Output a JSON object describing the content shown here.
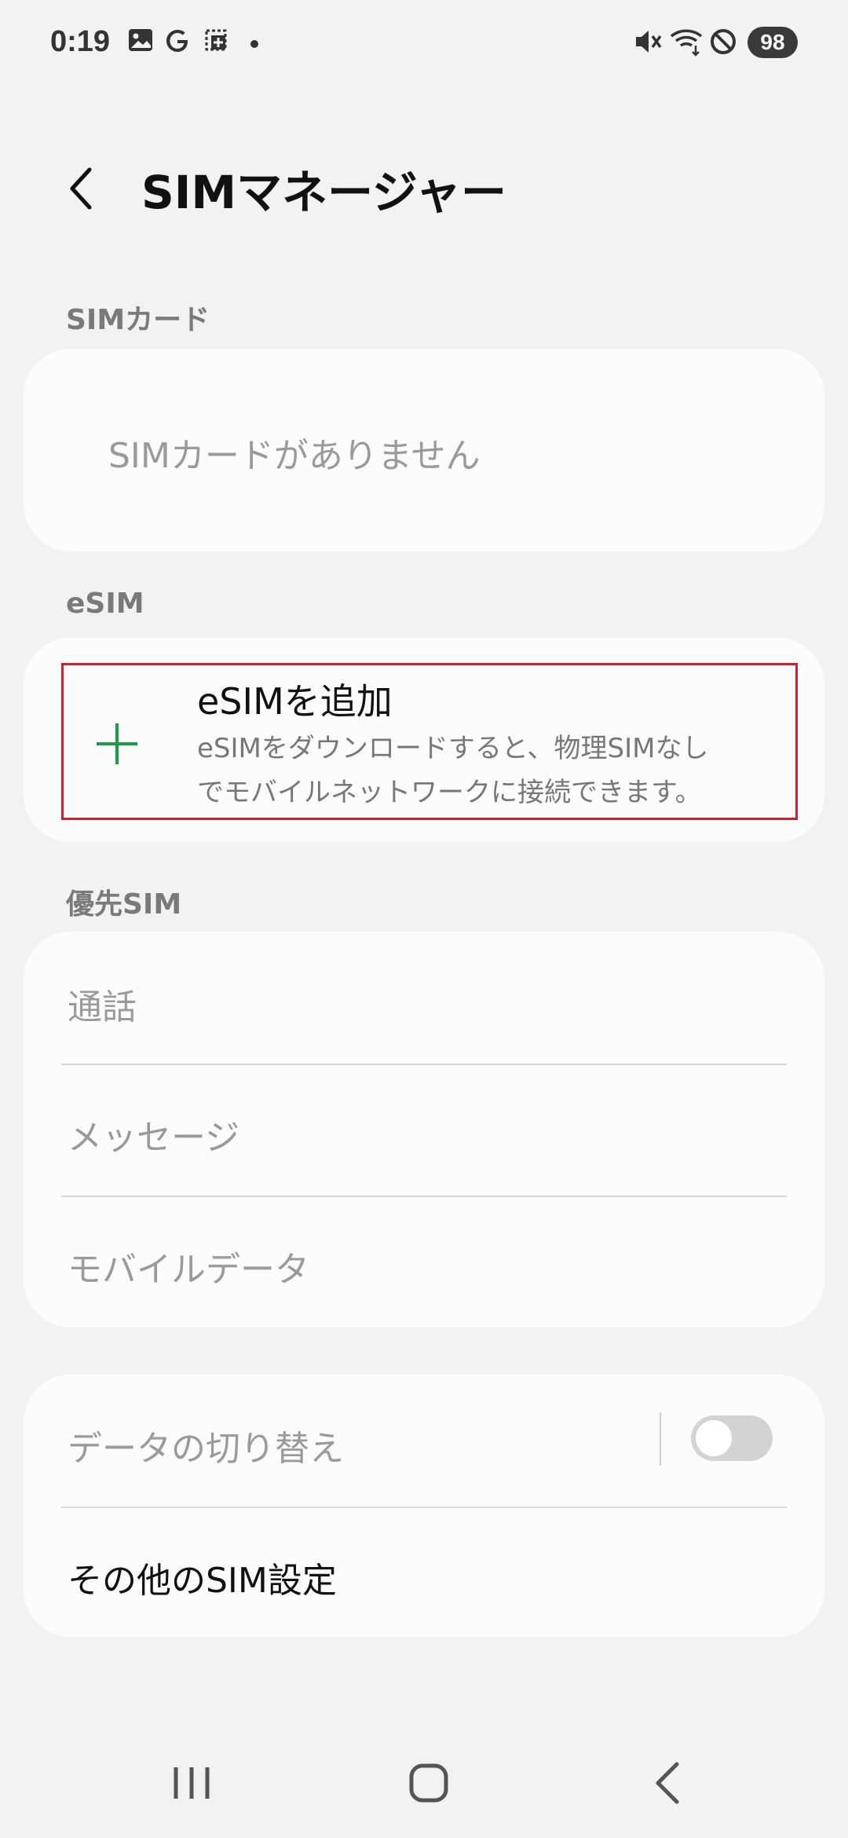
{
  "status_bar": {
    "time": "0:19",
    "left_icons": [
      "gallery-icon",
      "google-icon",
      "screenshot-icon",
      "dot-icon"
    ],
    "right_icons": [
      "mute-icon",
      "wifi-icon",
      "do-not-disturb-icon"
    ],
    "battery": "98"
  },
  "app_bar": {
    "title": "SIMマネージャー",
    "back_icon": "back-icon"
  },
  "sim_card_section": {
    "label": "SIMカード",
    "empty_text": "SIMカードがありません"
  },
  "esim_section": {
    "label": "eSIM",
    "add_title": "eSIMを追加",
    "add_desc_line1": "eSIMをダウンロードすると、物理SIMなし",
    "add_desc_line2": "でモバイルネットワークに接続できます。",
    "add_icon": "plus-icon",
    "accent_color": "#1a9e45"
  },
  "preferred_sim_section": {
    "label": "優先SIM",
    "items": [
      "通話",
      "メッセージ",
      "モバイルデータ"
    ]
  },
  "more_section": {
    "data_switch_label": "データの切り替え",
    "data_switch_on": false,
    "more_settings_label": "その他のSIM設定"
  },
  "nav_bar": {
    "icons": [
      "recent-apps-icon",
      "home-icon",
      "back-nav-icon"
    ]
  }
}
